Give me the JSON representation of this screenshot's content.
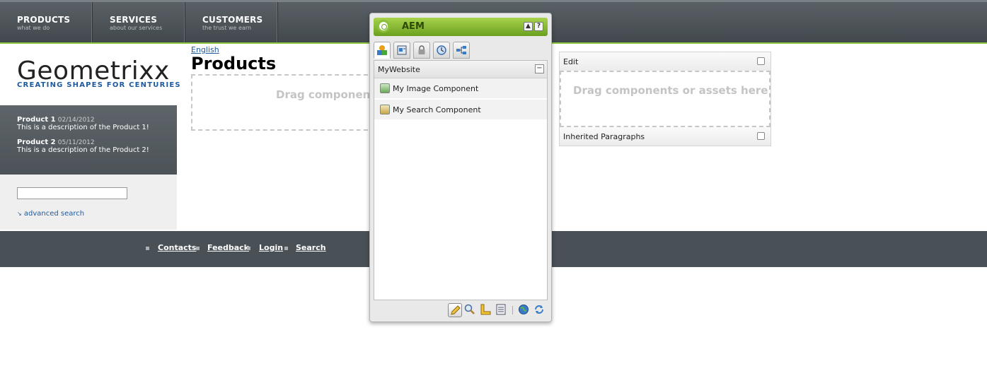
{
  "nav": {
    "items": [
      {
        "title": "PRODUCTS",
        "sub": "what we do"
      },
      {
        "title": "SERVICES",
        "sub": "about our services"
      },
      {
        "title": "CUSTOMERS",
        "sub": "the trust we earn"
      }
    ]
  },
  "brand": {
    "logo": "Geometrixx",
    "tagline": "CREATING SHAPES FOR CENTURIES",
    "accent": "#8dc63f",
    "link_color": "#1e5a9e"
  },
  "products": [
    {
      "name": "Product 1",
      "date": "02/14/2012",
      "desc": "This is a description of the Product 1!"
    },
    {
      "name": "Product 2",
      "date": "05/11/2012",
      "desc": "This is a description of the Product 2!"
    }
  ],
  "search": {
    "value": "",
    "advanced_label": "advanced search"
  },
  "main": {
    "language_link": "English",
    "title": "Products",
    "dropzone_text": "Drag components or assets here"
  },
  "parsys": {
    "edit_label": "Edit",
    "dropzone_text": "Drag components or assets here",
    "inherited_label": "Inherited Paragraphs"
  },
  "footer": {
    "links": [
      "Contacts",
      "Feedback",
      "Login",
      "Search"
    ]
  },
  "sidekick": {
    "title": "AEM",
    "tabs": [
      "components-icon",
      "page-icon",
      "lock-icon",
      "clock-icon",
      "workflow-icon"
    ],
    "group": "MyWebsite",
    "components": [
      {
        "label": "My Image Component",
        "icon": "image-component-icon"
      },
      {
        "label": "My Search Component",
        "icon": "search-component-icon"
      }
    ],
    "footer_buttons": [
      "edit-pencil-icon",
      "preview-magnifier-icon",
      "design-ruler-icon",
      "scaffolding-icon",
      "publish-globe-icon",
      "refresh-icon"
    ]
  }
}
